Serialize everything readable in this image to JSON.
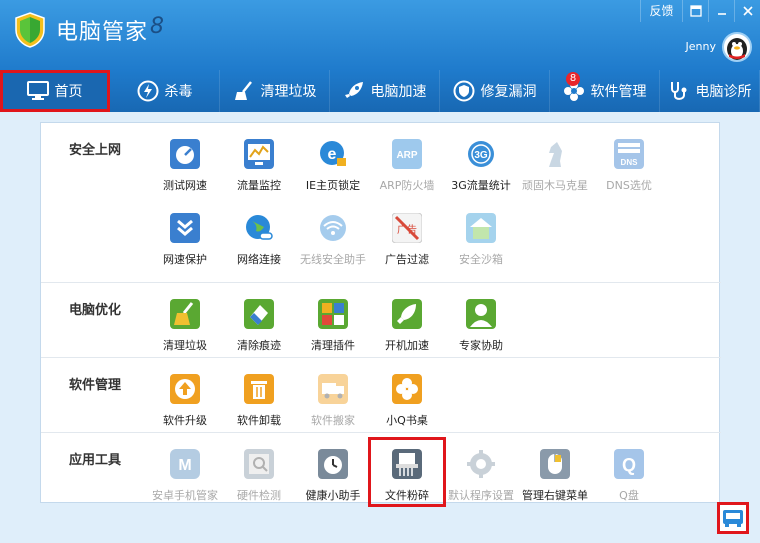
{
  "window": {
    "title": "电脑管家",
    "mark": "8",
    "feedback": "反馈",
    "user": "Jenny"
  },
  "nav": [
    {
      "label": "首页",
      "icon": "monitor-icon"
    },
    {
      "label": "杀毒",
      "icon": "lightning-icon"
    },
    {
      "label": "清理垃圾",
      "icon": "broom-icon"
    },
    {
      "label": "电脑加速",
      "icon": "rocket-icon"
    },
    {
      "label": "修复漏洞",
      "icon": "shield-repair-icon"
    },
    {
      "label": "软件管理",
      "icon": "flower-icon",
      "badge": "8"
    },
    {
      "label": "电脑诊所",
      "icon": "stethoscope-icon"
    }
  ],
  "sections": [
    {
      "title": "安全上网",
      "rows": [
        [
          {
            "label": "测试网速",
            "icon": "speed-gauge-icon",
            "color": "#3a7fcf",
            "disabled": false
          },
          {
            "label": "流量监控",
            "icon": "chart-monitor-icon",
            "color": "#3a7fcf",
            "disabled": false
          },
          {
            "label": "IE主页锁定",
            "icon": "ie-lock-icon",
            "color": "#2a89d8",
            "disabled": false
          },
          {
            "label": "ARP防火墙",
            "icon": "arp-icon",
            "color": "#2a89d8",
            "disabled": true
          },
          {
            "label": "3G流量统计",
            "icon": "3g-icon",
            "color": "#3a8fd8",
            "disabled": false
          },
          {
            "label": "顽固木马克星",
            "icon": "horse-icon",
            "color": "#8aa7c2",
            "disabled": true
          },
          {
            "label": "DNS选优",
            "icon": "dns-icon",
            "color": "#3a7fcf",
            "disabled": true
          }
        ],
        [
          {
            "label": "网速保护",
            "icon": "chevron-shield-icon",
            "color": "#3a7fcf",
            "disabled": false
          },
          {
            "label": "网络连接",
            "icon": "globe-link-icon",
            "color": "#2a89d8",
            "disabled": false
          },
          {
            "label": "无线安全助手",
            "icon": "wifi-icon",
            "color": "#3a8fd8",
            "disabled": true
          },
          {
            "label": "广告过滤",
            "icon": "ad-block-icon",
            "color": "#d84a3a",
            "disabled": false
          },
          {
            "label": "安全沙箱",
            "icon": "sandbox-icon",
            "color": "#3aa0d8",
            "disabled": true
          }
        ]
      ]
    },
    {
      "title": "电脑优化",
      "rows": [
        [
          {
            "label": "清理垃圾",
            "icon": "broom-tool-icon",
            "color": "#5aa832",
            "disabled": false
          },
          {
            "label": "清除痕迹",
            "icon": "eraser-icon",
            "color": "#5aa832",
            "disabled": false
          },
          {
            "label": "清理插件",
            "icon": "puzzle-icon",
            "color": "#5aa832",
            "disabled": false
          },
          {
            "label": "开机加速",
            "icon": "launch-icon",
            "color": "#5aa832",
            "disabled": false
          },
          {
            "label": "专家协助",
            "icon": "expert-icon",
            "color": "#5aa832",
            "disabled": false
          }
        ]
      ]
    },
    {
      "title": "软件管理",
      "rows": [
        [
          {
            "label": "软件升级",
            "icon": "upgrade-arrow-icon",
            "color": "#f0a020",
            "disabled": false
          },
          {
            "label": "软件卸载",
            "icon": "trash-icon",
            "color": "#f0a020",
            "disabled": false
          },
          {
            "label": "软件搬家",
            "icon": "truck-icon",
            "color": "#f0a020",
            "disabled": true
          },
          {
            "label": "小Q书桌",
            "icon": "clover-icon",
            "color": "#f0a020",
            "disabled": false
          }
        ]
      ]
    },
    {
      "title": "应用工具",
      "rows": [
        [
          {
            "label": "安卓手机管家",
            "icon": "android-m-icon",
            "color": "#5a8fc0",
            "disabled": true
          },
          {
            "label": "硬件检测",
            "icon": "hardware-scan-icon",
            "color": "#8a9aaa",
            "disabled": true
          },
          {
            "label": "健康小助手",
            "icon": "alarm-clock-icon",
            "color": "#7a8a9a",
            "disabled": false
          },
          {
            "label": "文件粉碎",
            "icon": "shredder-icon",
            "color": "#5a6a7a",
            "disabled": false,
            "highlight": true
          },
          {
            "label": "默认程序设置",
            "icon": "gear-icon",
            "color": "#8a9aaa",
            "disabled": true
          },
          {
            "label": "管理右键菜单",
            "icon": "mouse-icon",
            "color": "#8a9aaa",
            "disabled": false
          },
          {
            "label": "Q盘",
            "icon": "q-disk-icon",
            "color": "#3a7fcf",
            "disabled": true
          }
        ]
      ]
    }
  ],
  "icon_text": {
    "arp": "ARP",
    "g3": "3G",
    "dns": "DNS",
    "ad": "广告",
    "q": "Q",
    "m": "M"
  }
}
